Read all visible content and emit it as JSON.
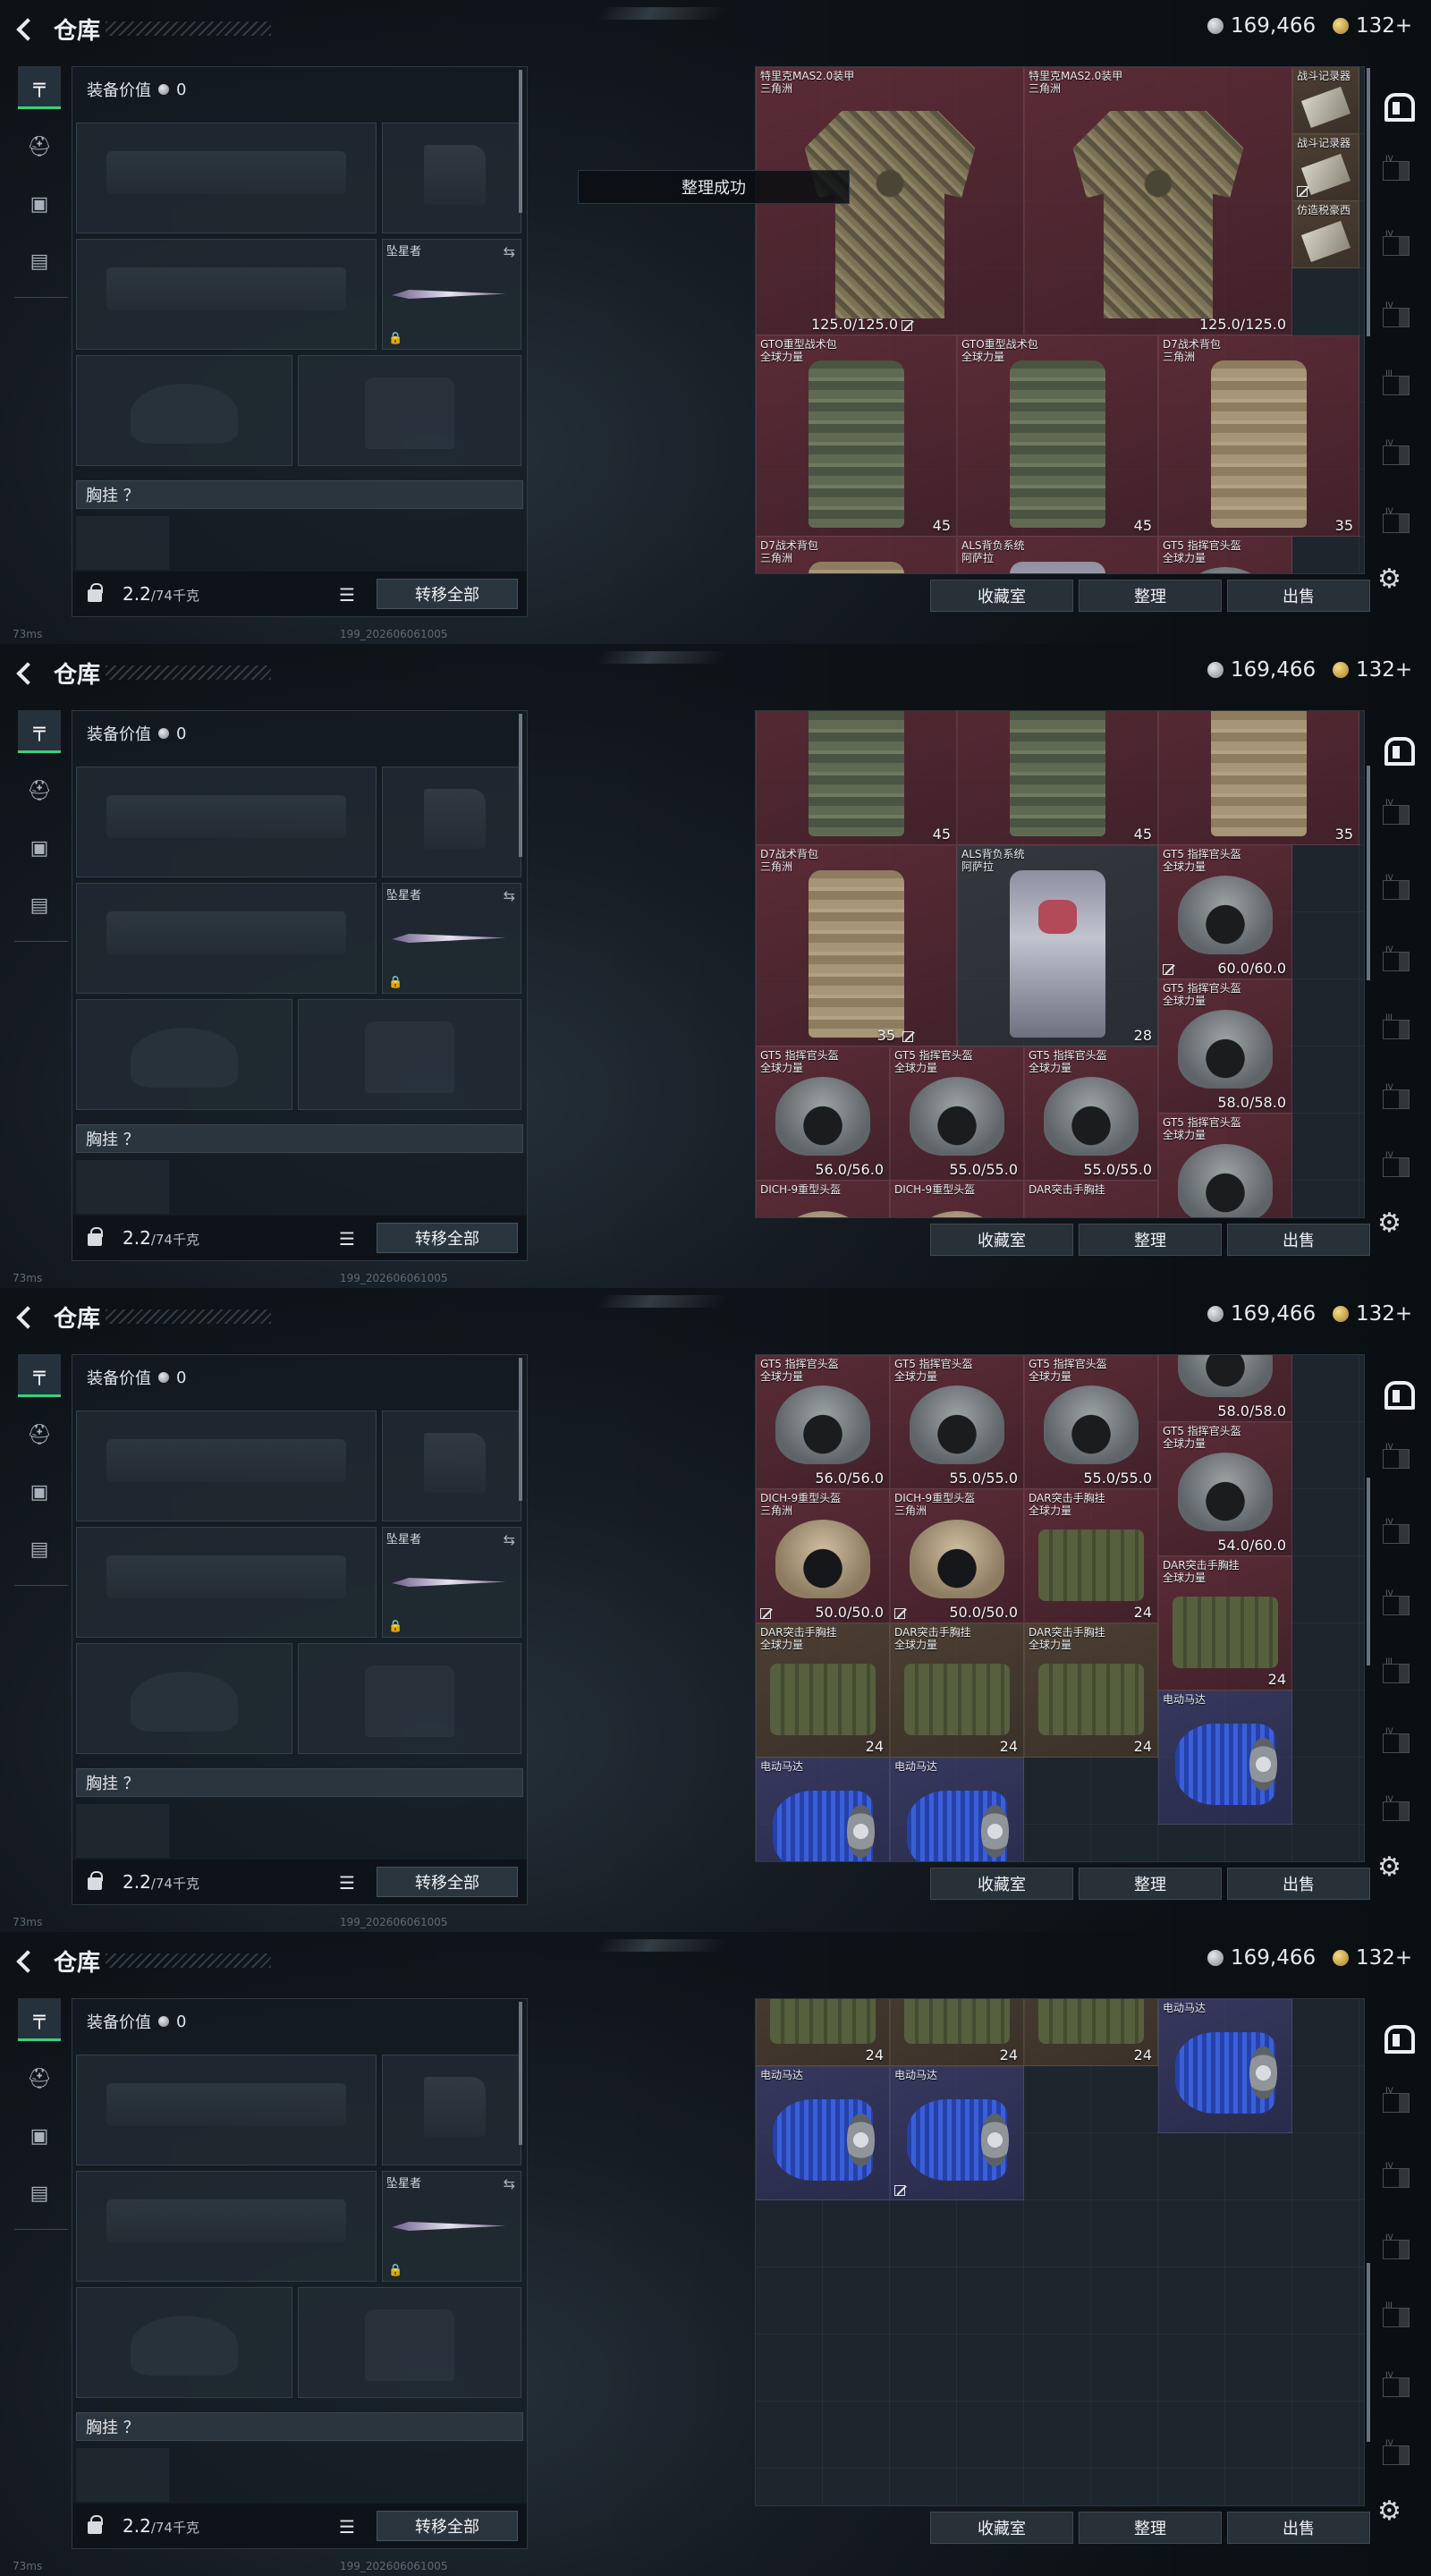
{
  "frames": [
    {
      "header": {
        "title": "仓库",
        "currency1": "169,466",
        "currency2": "132+"
      },
      "equipment": {
        "value_label": "装备价值",
        "value": "0",
        "melee_name": "坠星者",
        "chest_label": "胸挂 ？",
        "weight": "2.2",
        "weight_max": "/74千克",
        "transfer_label": "转移全部"
      },
      "toast": "整理成功",
      "buttons": {
        "collection": "收藏室",
        "organize": "整理",
        "sell": "出售"
      },
      "status": {
        "ping": "73ms",
        "build": "199_202606061005"
      },
      "items": [
        {
          "name": "特里克MAS2.0装甲\n三角洲",
          "label": "125.0/125.0",
          "mark": true
        },
        {
          "name": "特里克MAS2.0装甲\n三角洲",
          "label": "125.0/125.0"
        },
        {
          "name": "战斗记录器"
        },
        {
          "name": "战斗记录器",
          "mark": true
        },
        {
          "name": "仿造税豪西"
        },
        {
          "name": "GTO重型战术包\n全球力量",
          "label": "45"
        },
        {
          "name": "GTO重型战术包\n全球力量",
          "label": "45"
        },
        {
          "name": "D7战术背包\n三角洲",
          "label": "35"
        },
        {
          "name": "D7战术背包\n三角洲"
        },
        {
          "name": "ALS背负系统\n阿萨拉"
        },
        {
          "name": "GT5 指挥官头盔\n全球力量"
        }
      ]
    },
    {
      "header": {
        "title": "仓库",
        "currency1": "169,466",
        "currency2": "132+"
      },
      "equipment": {
        "value_label": "装备价值",
        "value": "0",
        "melee_name": "坠星者",
        "chest_label": "胸挂 ？",
        "weight": "2.2",
        "weight_max": "/74千克",
        "transfer_label": "转移全部"
      },
      "buttons": {
        "collection": "收藏室",
        "organize": "整理",
        "sell": "出售"
      },
      "status": {
        "ping": "73ms",
        "build": "199_202606061005"
      },
      "items": [
        {
          "label": "45"
        },
        {
          "label": "45"
        },
        {
          "label": "35"
        },
        {
          "name": "D7战术背包\n三角洲",
          "label": "35",
          "mark": true
        },
        {
          "name": "ALS背负系统\n阿萨拉",
          "label": "28"
        },
        {
          "name": "GT5 指挥官头盔\n全球力量",
          "label": "60.0/60.0",
          "mark": true
        },
        {
          "name": "GT5 指挥官头盔\n全球力量",
          "label": "58.0/58.0"
        },
        {
          "name": "GT5 指挥官头盔\n全球力量",
          "label": "56.0/56.0"
        },
        {
          "name": "GT5 指挥官头盔\n全球力量",
          "label": "55.0/55.0"
        },
        {
          "name": "GT5 指挥官头盔\n全球力量",
          "label": "55.0/55.0"
        },
        {
          "name": "GT5 指挥官头盔\n全球力量"
        },
        {
          "name": "DICH-9重型头盔"
        },
        {
          "name": "DICH-9重型头盔"
        },
        {
          "name": "DAR突击手胸挂"
        }
      ]
    },
    {
      "header": {
        "title": "仓库",
        "currency1": "169,466",
        "currency2": "132+"
      },
      "equipment": {
        "value_label": "装备价值",
        "value": "0",
        "melee_name": "坠星者",
        "chest_label": "胸挂 ？",
        "weight": "2.2",
        "weight_max": "/74千克",
        "transfer_label": "转移全部"
      },
      "buttons": {
        "collection": "收藏室",
        "organize": "整理",
        "sell": "出售"
      },
      "status": {
        "ping": "73ms",
        "build": "199_202606061005"
      },
      "items": [
        {
          "name": "GT5 指挥官头盔\n全球力量",
          "label": "56.0/56.0"
        },
        {
          "name": "GT5 指挥官头盔\n全球力量",
          "label": "55.0/55.0"
        },
        {
          "name": "GT5 指挥官头盔\n全球力量",
          "label": "55.0/55.0"
        },
        {
          "label": "58.0/58.0"
        },
        {
          "name": "GT5 指挥官头盔\n全球力量",
          "label": "54.0/60.0"
        },
        {
          "name": "DICH-9重型头盔\n三角洲",
          "label": "50.0/50.0",
          "mark": true
        },
        {
          "name": "DICH-9重型头盔\n三角洲",
          "label": "50.0/50.0",
          "mark": true
        },
        {
          "name": "DAR突击手胸挂\n全球力量",
          "label": "24"
        },
        {
          "name": "DAR突击手胸挂\n全球力量",
          "label": "24"
        },
        {
          "name": "DAR突击手胸挂\n全球力量",
          "label": "24"
        },
        {
          "name": "DAR突击手胸挂\n全球力量",
          "label": "24"
        },
        {
          "name": "DAR突击手胸挂\n全球力量",
          "label": "24"
        },
        {
          "name": "电动马达"
        },
        {
          "name": "电动马达"
        },
        {
          "name": "电动马达"
        }
      ]
    },
    {
      "header": {
        "title": "仓库",
        "currency1": "169,466",
        "currency2": "132+"
      },
      "equipment": {
        "value_label": "装备价值",
        "value": "0",
        "melee_name": "坠星者",
        "chest_label": "胸挂 ？",
        "weight": "2.2",
        "weight_max": "/74千克",
        "transfer_label": "转移全部"
      },
      "buttons": {
        "collection": "收藏室",
        "organize": "整理",
        "sell": "出售"
      },
      "status": {
        "ping": "73ms",
        "build": "199_202606061005"
      },
      "items": [
        {
          "label": "24"
        },
        {
          "label": "24"
        },
        {
          "label": "24"
        },
        {
          "name": "电动马达"
        },
        {
          "name": "电动马达"
        },
        {
          "name": "电动马达",
          "mark": true
        }
      ]
    }
  ]
}
